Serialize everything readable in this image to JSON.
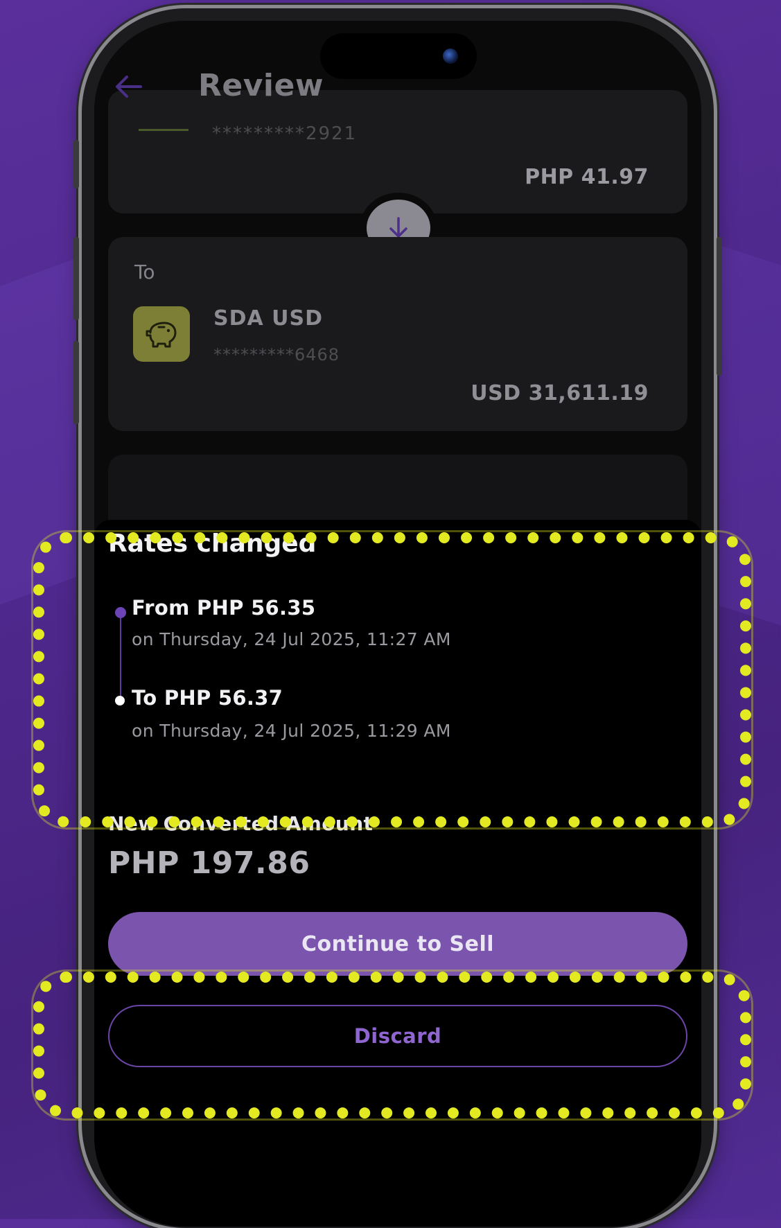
{
  "header": {
    "title": "Review"
  },
  "from_card": {
    "masked_number": "*********2921",
    "balance": "PHP 41.97"
  },
  "to_card": {
    "label": "To",
    "account_name": "SDA USD",
    "masked_number": "*********6468",
    "balance": "USD 31,611.19"
  },
  "rates": {
    "title": "Rates changed",
    "from_text": "From PHP 56.35",
    "from_date": "on Thursday, 24 Jul 2025, 11:27 AM",
    "to_text": "To PHP 56.37",
    "to_date": "on Thursday, 24 Jul 2025, 11:29 AM"
  },
  "converted": {
    "label": "New Converted Amount",
    "value": "PHP 197.86"
  },
  "actions": {
    "continue_label": "Continue to Sell",
    "discard_label": "Discard"
  },
  "colors": {
    "background": "#4d278a",
    "accent_purple": "#7b55ad",
    "highlight_yellow": "#e4ea22",
    "account_icon_bg": "#7d7f37"
  },
  "icons": {
    "back": "arrow-left-icon",
    "swap": "arrow-down-icon",
    "account": "piggy-bank-icon"
  }
}
